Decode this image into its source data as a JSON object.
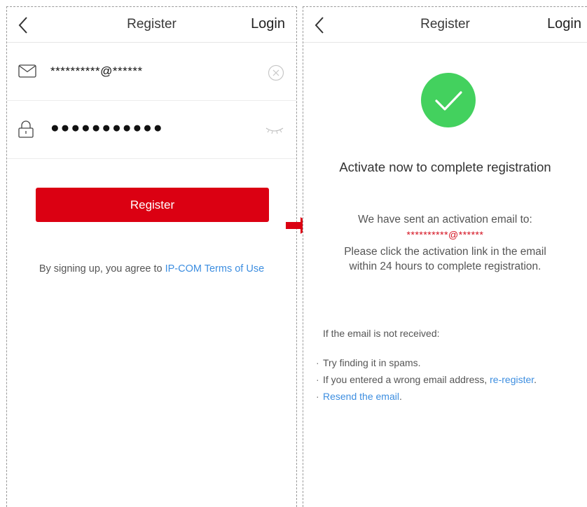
{
  "register_screen": {
    "nav": {
      "title": "Register",
      "login_label": "Login",
      "back_icon": "chevron-left-icon"
    },
    "email": {
      "value": "**********@******",
      "icon": "mail-icon",
      "clear_icon": "clear-circle-icon"
    },
    "password": {
      "value": "●●●●●●●●●●●",
      "icon": "lock-icon",
      "toggle_icon": "eye-closed-icon"
    },
    "register_button": "Register",
    "terms": {
      "prefix": "By signing up, you agree to ",
      "link": "IP-COM Terms of Use"
    }
  },
  "flow_arrow": {
    "icon": "right-arrow-icon",
    "color": "#db0012"
  },
  "activation_screen": {
    "nav": {
      "title": "Register",
      "login_label": "Login",
      "back_icon": "chevron-left-icon"
    },
    "success_icon": "check-circle-icon",
    "heading": "Activate now to complete registration",
    "message": {
      "sent": "We have sent an activation email to:",
      "email": "**********@******",
      "line1": "Please click the activation link in the email",
      "line2": "within 24 hours to complete registration."
    },
    "help": {
      "title": "If the email is not received:",
      "item1": "Try finding it in spams.",
      "item2_prefix": "If you entered a wrong email address, ",
      "item2_link": "re-register",
      "item2_suffix": ".",
      "item3_link": "Resend the email",
      "item3_suffix": "."
    }
  },
  "colors": {
    "brand_red": "#db0012",
    "link_blue": "#3d8ee0",
    "success_green": "#43d15e"
  }
}
